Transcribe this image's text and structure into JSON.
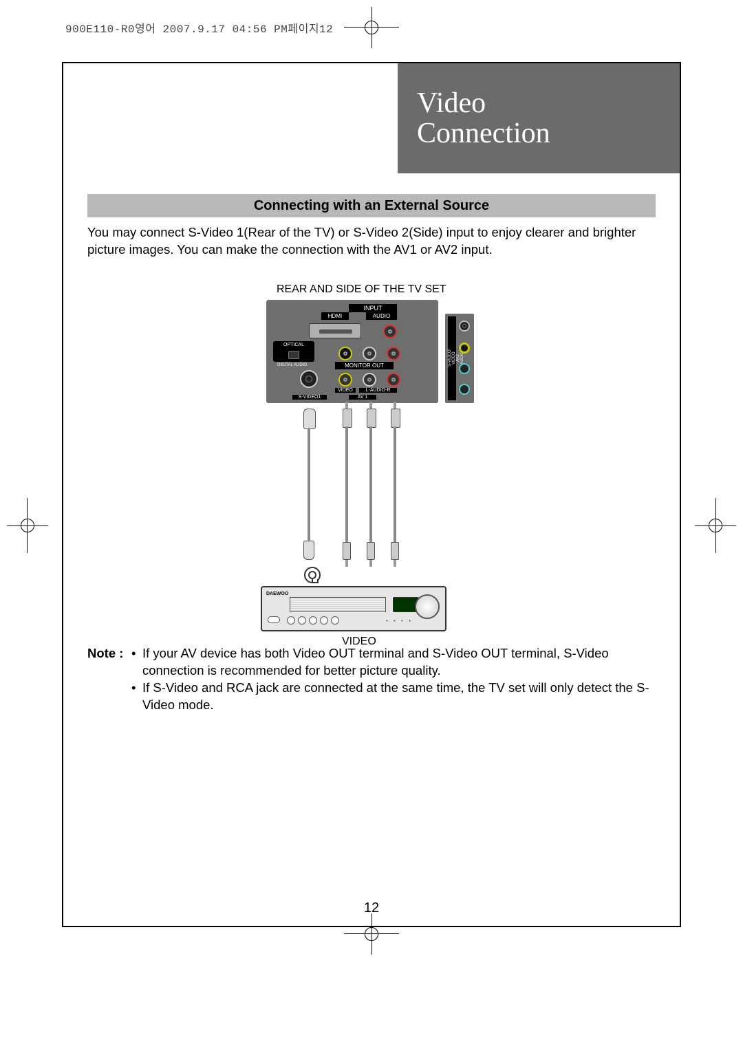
{
  "print_header": "900E110-R0영어  2007.9.17 04:56 PM페이지12",
  "title": {
    "line1": "Video",
    "line2": "Connection"
  },
  "section_heading": "Connecting with an External Source",
  "intro": "You may connect S-Video 1(Rear of the TV) or S-Video 2(Side) input to enjoy clearer and brighter picture images. You can make the connection with the AV1 or AV2 input.",
  "diagram": {
    "top_caption": "REAR AND SIDE OF THE TV SET",
    "rear_labels": {
      "input": "INPUT",
      "hdmi": "HDMI",
      "audio": "AUDIO",
      "optical": "OPTICAL",
      "digital_audio": "DIGITAL AUDIO",
      "monitor_out": "MONITOR OUT",
      "video": "VIDEO",
      "l_audio_r": "L-AUDIO-R",
      "svideo1": "S-VIDEO1",
      "av1": "AV 1"
    },
    "side_labels": {
      "svideo": "S-VIDEO",
      "video": "VIDEO",
      "av2": "AV2",
      "l_audio_r": "R-AUDIO-L"
    },
    "vcr_brand": "DAEWOO",
    "bottom_caption": "VIDEO"
  },
  "note": {
    "label": "Note :",
    "items": [
      "If your AV device has both Video OUT terminal and S-Video OUT terminal, S-Video connection is recommended for better picture quality.",
      "If S-Video and RCA jack are connected at the same time, the TV set will only detect the S-Video mode."
    ]
  },
  "page_number": "12"
}
